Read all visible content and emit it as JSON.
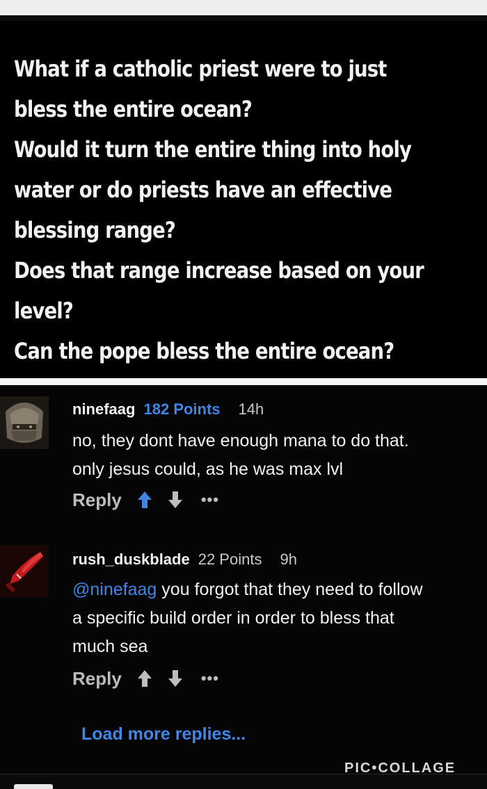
{
  "post": {
    "lines": [
      "What if a catholic priest were to just",
      "bless the entire ocean?",
      "Would it turn the entire thing into holy",
      "water or do priests have an effective",
      "blessing range?",
      "Does that range increase based on your",
      "level?",
      "Can the pope bless the entire ocean?"
    ]
  },
  "comments": [
    {
      "username": "ninefaag",
      "points": "182 Points",
      "time": "14h",
      "lines": [
        "no, they dont have enough mana to do that.",
        "only jesus could, as he was max lvl"
      ],
      "reply_label": "Reply",
      "upvote_color": "#3f86e6",
      "avatar_icon": "helmet-icon"
    },
    {
      "username": "rush_duskblade",
      "points": "22 Points",
      "time": "9h",
      "mention": "@ninefaag",
      "lines": [
        " you forgot that they need to follow",
        "a specific build order in order to bless that",
        "much sea"
      ],
      "reply_label": "Reply",
      "upvote_color": "#bdbdbd",
      "avatar_icon": "blade-icon"
    }
  ],
  "load_more_label": "Load more replies...",
  "watermark": "PIC•COLLAGE",
  "colors": {
    "accent": "#3f86e6",
    "background": "#000000",
    "text": "#f0f0f0"
  }
}
